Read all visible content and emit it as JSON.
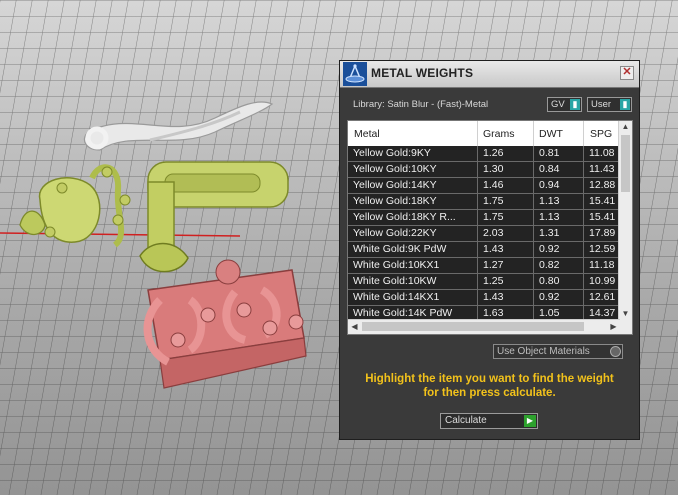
{
  "window": {
    "title": "METAL WEIGHTS",
    "close_label": "✕"
  },
  "library": {
    "label": "Library: Satin Blur - (Fast)-Metal",
    "gv_label": "GV",
    "user_label": "User"
  },
  "table": {
    "columns": [
      "Metal",
      "Grams",
      "DWT",
      "SPG"
    ],
    "rows": [
      [
        "Yellow Gold:9KY",
        "1.26",
        "0.81",
        "11.08"
      ],
      [
        "Yellow Gold:10KY",
        "1.30",
        "0.84",
        "11.43"
      ],
      [
        "Yellow Gold:14KY",
        "1.46",
        "0.94",
        "12.88"
      ],
      [
        "Yellow Gold:18KY",
        "1.75",
        "1.13",
        "15.41"
      ],
      [
        "Yellow Gold:18KY R...",
        "1.75",
        "1.13",
        "15.41"
      ],
      [
        "Yellow Gold:22KY",
        "2.03",
        "1.31",
        "17.89"
      ],
      [
        "White Gold:9K PdW",
        "1.43",
        "0.92",
        "12.59"
      ],
      [
        "White Gold:10KX1",
        "1.27",
        "0.82",
        "11.18"
      ],
      [
        "White Gold:10KW",
        "1.25",
        "0.80",
        "10.99"
      ],
      [
        "White Gold:14KX1",
        "1.43",
        "0.92",
        "12.61"
      ],
      [
        "White Gold:14K PdW",
        "1.63",
        "1.05",
        "14.37"
      ]
    ]
  },
  "use_object_materials_label": "Use Object Materials",
  "instruction_line1": "Highlight the item you want to find the weight",
  "instruction_line2": "for then press calculate.",
  "calculate_label": "Calculate",
  "colors": {
    "panel_bg": "#3a3a3a",
    "row_bg": "#232323",
    "instruction": "#f2c21b",
    "accent_teal": "#2aa6a6",
    "calc_green": "#2da12d"
  }
}
